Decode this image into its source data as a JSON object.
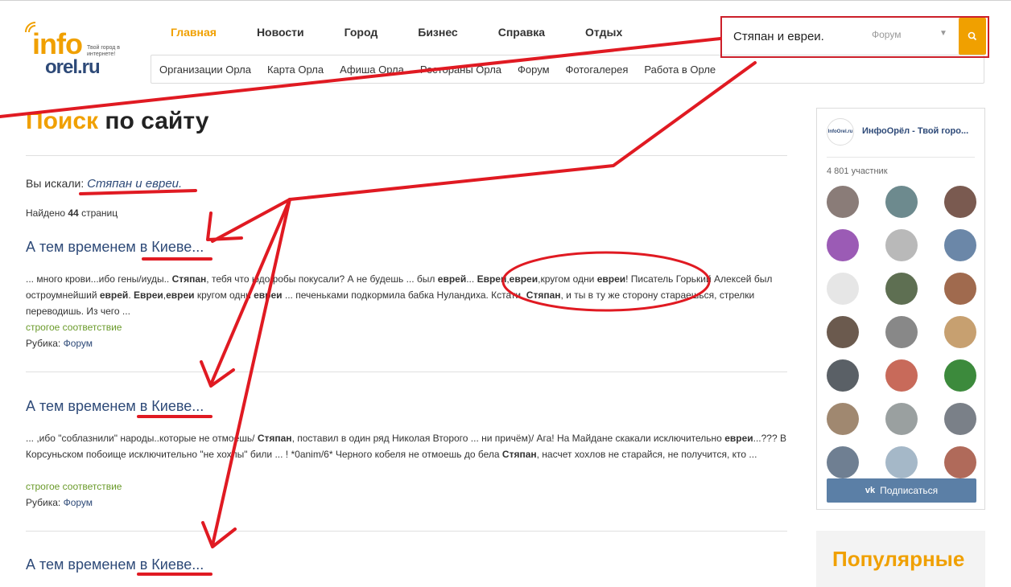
{
  "logo": {
    "info": "info",
    "orel": "orel.ru",
    "tagline": "Твой город в интернете!"
  },
  "main_nav": [
    {
      "label": "Главная",
      "active": true
    },
    {
      "label": "Новости"
    },
    {
      "label": "Город"
    },
    {
      "label": "Бизнес"
    },
    {
      "label": "Справка"
    },
    {
      "label": "Отдых"
    }
  ],
  "sub_nav": [
    "Организации Орла",
    "Карта Орла",
    "Афиша Орла",
    "Рестораны Орла",
    "Форум",
    "Фотогалерея",
    "Работа в Орле"
  ],
  "search": {
    "value": "Стяпан и евреи.",
    "category": "Форум"
  },
  "page": {
    "title_highlight": "Поиск",
    "title_rest": "по сайту",
    "query_label": "Вы искали:",
    "query": "Стяпан и евреи.",
    "found_prefix": "Найдено",
    "found_count": "44",
    "found_suffix": "страниц"
  },
  "results": [
    {
      "title": "А тем временем в Киеве...",
      "snippet_html": "... много крови...ибо гены/иуды.. <b>Стяпан</b>, тебя что юдофобы покусали? А не будешь ... был <b>еврей</b>... <b>Евреи</b>,<b>евреи</b>,кругом одни <b>евреи</b>! Писатель Горький Алексей был остроумнейший <b>еврей</b>. <b>Евреи</b>,<b>евреи</b> кругом одни <b>евреи</b> ... печеньками подкормила бабка Нуландиха. Кстати, <b>Стяпан</b>, и ты в ту же сторону стараешься, стрелки переводишь. Из чего ...",
      "match": "строгое соответствие",
      "rubric_label": "Рубика:",
      "rubric": "Форум"
    },
    {
      "title": "А тем временем в Киеве...",
      "snippet_html": "... ,ибо \"соблазнили\" народы..которые не отмоешь/ <b>Стяпан</b>, поставил в один ряд Николая Второго ... ни причём)/ Ага! На Майдане скакали исключительно <b>евреи</b>...??? В Корсуньском побоище исключительно \"не хохлы\" били ... ! *0anim/6* Черного кобеля не отмоешь до бела <b>Стяпан</b>, насчет хохлов не старайся, не получится, кто ...",
      "match": "строгое соответствие",
      "rubric_label": "Рубика:",
      "rubric": "Форум"
    },
    {
      "title": "А тем временем в Киеве..."
    }
  ],
  "widget": {
    "logo_text": "InfoOrel.ru",
    "name": "ИнфоОрёл - Твой горо...",
    "members": "4 801 участник",
    "subscribe": "Подписаться",
    "avatar_colors": [
      "#8a7c78",
      "#6d8a8e",
      "#7a5a50",
      "#9b5bb5",
      "#b9b9b9",
      "#6b87a8",
      "#e6e6e6",
      "#5e6f52",
      "#a06a4e",
      "#6b5a4e",
      "#888888",
      "#c7a070",
      "#5a6066",
      "#c86a5a",
      "#3c8a3c",
      "#a08870",
      "#9aa0a0",
      "#7a8088",
      "#6f7f92",
      "#a5b8c8",
      "#b06a5a"
    ]
  },
  "popular": {
    "title": "Популярные"
  }
}
